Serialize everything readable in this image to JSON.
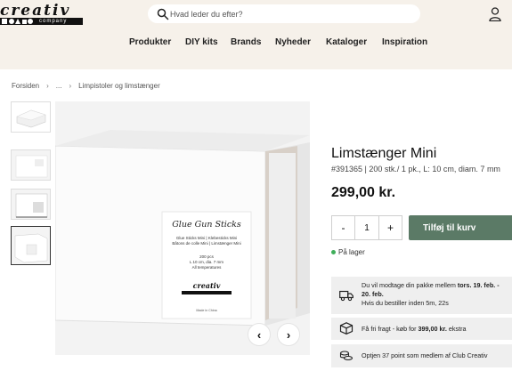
{
  "header": {
    "logo_text": "creativ",
    "logo_sub": "company",
    "search_placeholder": "Hvad leder du efter?",
    "nav": [
      "Produkter",
      "DIY kits",
      "Brands",
      "Nyheder",
      "Kataloger",
      "Inspiration"
    ]
  },
  "breadcrumb": [
    "Forsiden",
    "...",
    "Limpistoler og limstænger"
  ],
  "product": {
    "title": "Limstænger Mini",
    "subtitle": "#391365 | 200 stk./ 1 pk., L: 10 cm, diam. 7 mm",
    "price": "299,00 kr.",
    "quantity": "1",
    "qty_minus": "-",
    "qty_plus": "+",
    "add_to_cart": "Tilføj til kurv",
    "stock": "På lager"
  },
  "delivery": {
    "line1_pre": "Du vil modtage din pakke mellem ",
    "line1_dates": "tors. 19. feb. -",
    "line2": "20. feb.",
    "line3": "Hvis du bestiller inden 5m, 22s"
  },
  "shipping": {
    "pre": "Få fri fragt - køb for ",
    "amount": "399,00 kr.",
    "post": " ekstra"
  },
  "points": {
    "text": "Optjen 37 point som medlem af  Club Creativ"
  },
  "package": {
    "title": "Glue Gun Sticks",
    "line1": "Glue Sticks Mini  |  Klebesticks Mini",
    "line2": "Bâtons de colle Mini  |  Limstænger Mini",
    "line3": "200 pcs",
    "line4": "L 10 cm, dia. 7 mm",
    "line5": "All temperatures",
    "brand": "creativ",
    "made_in": "Made in China"
  },
  "colors": {
    "header_bg": "#f6f1ea",
    "accent": "#5b7a66",
    "in_stock": "#3fae5a"
  },
  "icons": [
    "search-icon",
    "user-icon",
    "chevron-left-icon",
    "chevron-right-icon",
    "truck-icon",
    "box-icon",
    "coins-icon"
  ]
}
